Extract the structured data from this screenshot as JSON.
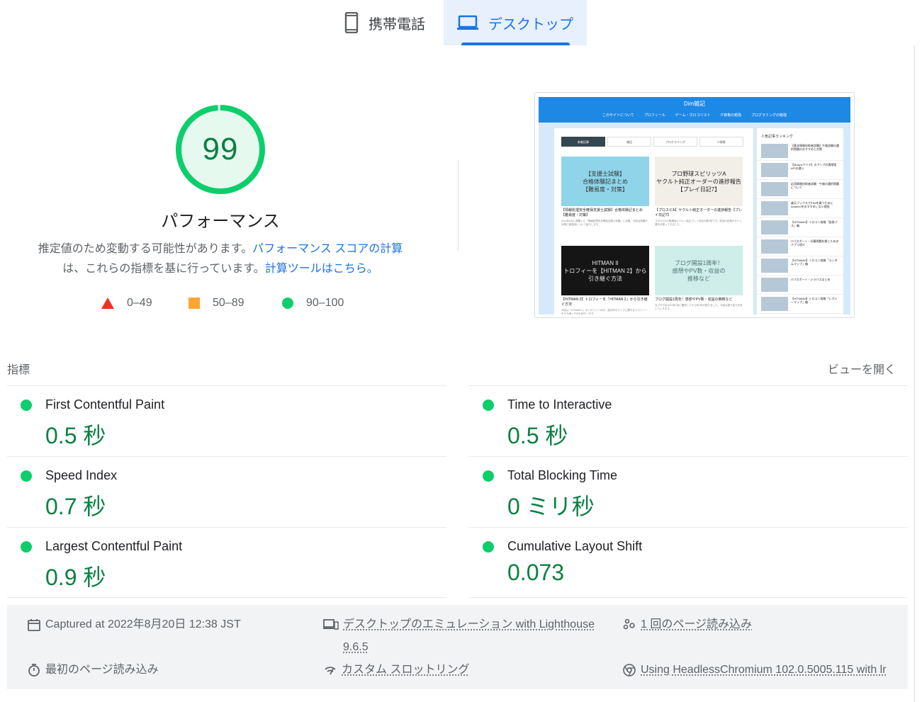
{
  "tabs": {
    "mobile": "携帯電話",
    "desktop": "デスクトップ"
  },
  "score": {
    "value": "99",
    "fraction": 0.99,
    "category": "パフォーマンス",
    "desc_text1": "推定値のため変動する可能性があります。",
    "desc_link1": "パフォーマンス スコアの計算",
    "desc_text2": "は、これらの指標を基に行っています。",
    "desc_link2": "計算ツールはこちら。"
  },
  "legend": {
    "fail": "0–49",
    "average": "50–89",
    "pass": "90–100"
  },
  "thumbnail": {
    "site_title": "Dim雑記",
    "nav": [
      "このサイトについて",
      "プロフィール",
      "ゲーム・ホロコリスト",
      "IT資格の勉強",
      "プログラミングの勉強"
    ],
    "tabs": [
      "新着記事",
      "雑記",
      "プログラミング",
      "IT資格"
    ],
    "cards": [
      {
        "image_text": "【支援士試験】\n合格体験記まとめ\n【難易度・対策】",
        "title": "【情報処理安全確保支援士試験】合格体験記まとめ【難易度・対策】",
        "text": "2022年4月に受験した「情報処理安全確保支援士試験」に合格。今回は試験の対策と難易度について紹介します。"
      },
      {
        "image_text": "プロ野球スピリッツA\nヤクルト純正オーダーの進捗報告\n【プレイ日記7】",
        "title": "【プロスピA】ヤクルト純正オーダーの進捗報告【プレイ日記7】",
        "text": "プロスピAの無課金ヤクルト純正プレイ日記の第7回です。前回の記事から少し選手が揃ってきました。"
      },
      {
        "image_text": "HITMAN II\nトロフィーを【HITMAN 2】から\n引き継ぐ方法",
        "title": "【HITMAN 2】トロフィーを「HITMAN 2」から引き継ぐ方法",
        "text": "今回は「HITMAN 2」のトロフィーの中、過去作のマップに関するトロフィーを引き継ぐ方法を紹介します。"
      },
      {
        "image_text": "ブログ開設1周年！\n感想やPV数・収益の\n推移など",
        "title": "ブログ開設1周年！感想やPV数・収益の推移など",
        "text": "当ブログを2021年7月に開設してから約1年が経ちました。今回は振り返りを書いていきます。"
      }
    ],
    "side_title": "人気記事ランキング",
    "side_items": [
      "【基本情報技術者試験】午後試験の選択問題のおすすめと対策",
      "【MoAnsフリマ】のアンプの通常版APIの違い",
      "応用情報技術者試験・午後の選択問題について",
      "楽天ブックスでPS5を買うためにAmazonをおすすめしない理由",
      "【HITMAN3】トロコン攻略「拡張パス」編",
      "ITパスポート・計算問題を解くためのアプリ紹介",
      "【HITMAN3】トロコン攻略「ランダムマップ」編",
      "ITパスポート・シラバスまとめ",
      "【HITMAN3】トロコン攻略「レガシーマップ」編"
    ]
  },
  "metrics": {
    "section_label": "指標",
    "toggle_view": "ビューを開く",
    "items": [
      {
        "name": "First Contentful Paint",
        "value": "0.5 秒"
      },
      {
        "name": "Time to Interactive",
        "value": "0.5 秒"
      },
      {
        "name": "Speed Index",
        "value": "0.7 秒"
      },
      {
        "name": "Total Blocking Time",
        "value": "0 ミリ秒"
      },
      {
        "name": "Largest Contentful Paint",
        "value": "0.9 秒"
      },
      {
        "name": "Cumulative Layout Shift",
        "value": "0.073"
      }
    ]
  },
  "footer": {
    "captured": "Captured at 2022年8月20日 12:38 JST",
    "emulation": "デスクトップのエミュレーション with Lighthouse",
    "emulation_version": "9.6.5",
    "page_loads": "1 回のページ読み込み",
    "initial_load": "最初のページ読み込み",
    "throttling": "カスタム スロットリング",
    "browser": "Using HeadlessChromium 102.0.5005.115 with lr"
  },
  "colors": {
    "pass": "#0cce6b",
    "pass_text": "#0b8043",
    "average": "#ffa631",
    "fail": "#eb3323",
    "accent": "#1a73e8"
  }
}
